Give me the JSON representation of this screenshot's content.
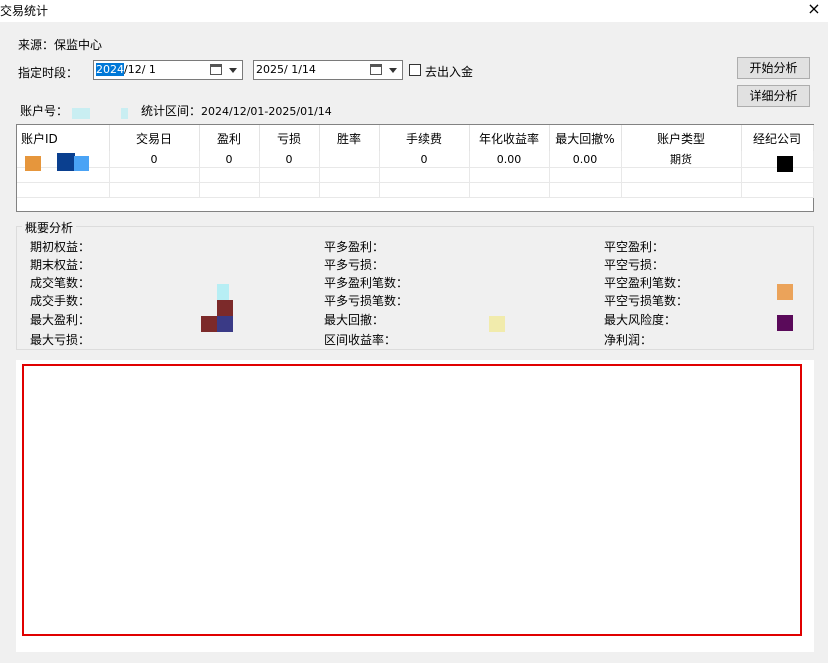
{
  "window": {
    "title": "交易统计",
    "close_glyph": "×"
  },
  "form": {
    "source_label": "来源：",
    "source_value": "保监中心",
    "period_label": "指定时段：",
    "start_date_selected": "2024",
    "start_date_rest": "/12/  1",
    "end_date": "2025/  1/14",
    "exclude_transfer_label": "去出入金",
    "exclude_transfer_checked": false,
    "account_label": "账户号：",
    "range_label": "统计区间：",
    "range_value": "2024/12/01-2025/01/14"
  },
  "buttons": {
    "start_analysis": "开始分析",
    "detail_analysis": "详细分析"
  },
  "table": {
    "columns": [
      "账户ID",
      "交易日",
      "盈利",
      "亏损",
      "胜率",
      "手续费",
      "年化收益率",
      "最大回撤%",
      "账户类型",
      "经纪公司"
    ],
    "rows": [
      [
        "",
        "0",
        "0",
        "0",
        "",
        "0",
        "0.00",
        "0.00",
        "期货",
        ""
      ]
    ]
  },
  "summary": {
    "title": "概要分析",
    "col1": [
      "期初权益：",
      "期末权益：",
      "成交笔数：",
      "成交手数：",
      "最大盈利：",
      "最大亏损："
    ],
    "col2": [
      "平多盈利：",
      "平多亏损：",
      "平多盈利笔数：",
      "平多亏损笔数：",
      "最大回撤：",
      "区间收益率："
    ],
    "col3": [
      "平空盈利：",
      "平空亏损：",
      "平空盈利笔数：",
      "平空亏损笔数：",
      "最大风险度：",
      "净利润："
    ]
  },
  "colors": {
    "highlight_border": "#e00000",
    "selection": "#0078d7"
  }
}
